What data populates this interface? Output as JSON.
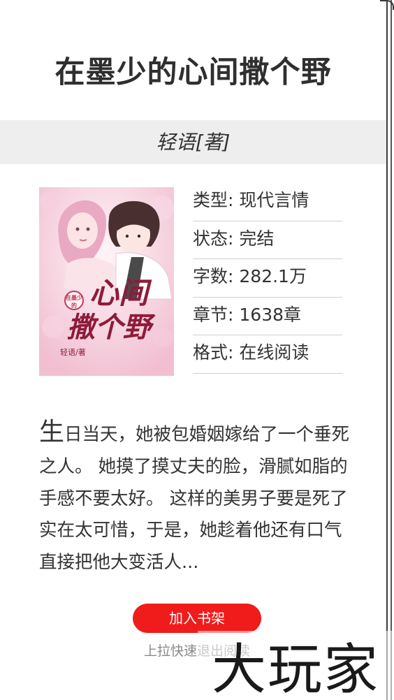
{
  "book": {
    "title": "在墨少的心间撒个野",
    "author_line": "轻语[著]",
    "cover": {
      "lettering_line1": "心间",
      "lettering_line2": "撒个野",
      "badge": "在墨少的",
      "author_mark": "轻语/著"
    },
    "meta": [
      {
        "key": "类型:",
        "value": "现代言情"
      },
      {
        "key": "状态:",
        "value": "完结"
      },
      {
        "key": "字数:",
        "value": "282.1万"
      },
      {
        "key": "章节:",
        "value": "1638章"
      },
      {
        "key": "格式:",
        "value": "在线阅读"
      }
    ],
    "summary_first_char": "生",
    "summary_rest": "日当天，她被包婚姻嫁给了一个垂死之人。 她摸了摸丈夫的脸，滑腻如脂的手感不要太好。 这样的美男子要是死了实在太可惜，于是，她趁着他还有口气直接把他大变活人..."
  },
  "actions": {
    "add_to_shelf": "加入书架",
    "pull_hint": "上拉快速退出阅读"
  },
  "watermark": {
    "text": "大玩家"
  },
  "colors": {
    "accent_button": "#f01b1b",
    "author_bar_bg": "#eeeeee",
    "title_text": "#2f2f2f"
  }
}
